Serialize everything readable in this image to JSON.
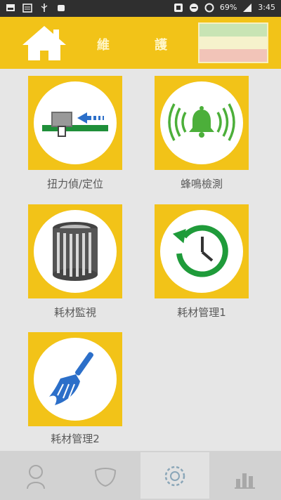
{
  "status_bar": {
    "battery": "69%",
    "time": "3:45",
    "left_icons": [
      "image-icon",
      "calendar-icon",
      "usb-icon",
      "android-icon"
    ],
    "right_icons": [
      "nfc-icon",
      "minus-circle-icon",
      "data-saver-icon",
      "signal-icon"
    ]
  },
  "header": {
    "home_icon": "home-icon",
    "title_part1": "維",
    "title_part2": "護",
    "flag_colors": [
      "#c8e4b4",
      "#f6f2cc",
      "#f2c4b8"
    ]
  },
  "tiles": [
    {
      "label": "扭力偵/定位",
      "icon": "torque-sensor-icon"
    },
    {
      "label": "蜂鳴檢測",
      "icon": "bell-ring-icon"
    },
    {
      "label": "耗材監視",
      "icon": "filter-cartridge-icon"
    },
    {
      "label": "耗材管理1",
      "icon": "history-clock-icon"
    },
    {
      "label": "耗材管理2",
      "icon": "broom-icon"
    }
  ],
  "bottom_nav": {
    "items": [
      "head-icon",
      "mask-icon",
      "maintenance-icon",
      "chart-icon"
    ],
    "active_index": 2
  },
  "colors": {
    "accent": "#f2c318",
    "background": "#e6e6e6",
    "green": "#1f9b3a",
    "blue": "#2c6fc9"
  }
}
